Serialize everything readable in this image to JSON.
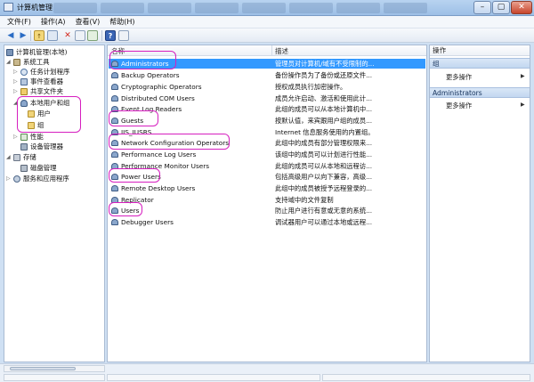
{
  "window": {
    "title": "计算机管理"
  },
  "menu": [
    "文件(F)",
    "操作(A)",
    "查看(V)",
    "帮助(H)"
  ],
  "toolbar": {
    "back_icon": "arrow-left-icon",
    "forward_icon": "arrow-right-icon",
    "up_icon": "folder-up-icon",
    "view_icon": "show-hide-console-tree-icon",
    "delete_icon": "delete-x-icon",
    "properties_icon": "properties-icon",
    "export_icon": "export-list-icon",
    "help_icon": "help-icon",
    "list_icon": "list-view-icon",
    "help_glyph": "?"
  },
  "tree": {
    "root": "计算机管理(本地)",
    "system_tools": "系统工具",
    "task_scheduler": "任务计划程序",
    "event_viewer": "事件查看器",
    "shared_folders": "共享文件夹",
    "local_users_groups": "本地用户和组",
    "users": "用户",
    "groups": "组",
    "performance": "性能",
    "device_manager": "设备管理器",
    "storage": "存储",
    "disk_management": "磁盘管理",
    "services_apps": "服务和应用程序"
  },
  "list": {
    "col_name": "名称",
    "col_desc": "描述",
    "rows": [
      {
        "name": "Administrators",
        "desc": "管理员对计算机/域有不受限制的..."
      },
      {
        "name": "Backup Operators",
        "desc": "备份操作员为了备份或还原文件..."
      },
      {
        "name": "Cryptographic Operators",
        "desc": "授权成员执行加密操作。"
      },
      {
        "name": "Distributed COM Users",
        "desc": "成员允许启动、激活和使用此计..."
      },
      {
        "name": "Event Log Readers",
        "desc": "此组的成员可以从本地计算机中..."
      },
      {
        "name": "Guests",
        "desc": "按默认值，来宾跟用户组的成员..."
      },
      {
        "name": "IIS_IUSRS",
        "desc": "Internet 信息服务使用的内置组。"
      },
      {
        "name": "Network Configuration Operators",
        "desc": "此组中的成员有部分管理权限来..."
      },
      {
        "name": "Performance Log Users",
        "desc": "该组中的成员可以计划进行性能..."
      },
      {
        "name": "Performance Monitor Users",
        "desc": "此组的成员可以从本地和远程访..."
      },
      {
        "name": "Power Users",
        "desc": "包括高级用户以向下兼容，高级..."
      },
      {
        "name": "Remote Desktop Users",
        "desc": "此组中的成员被授予远程登录的..."
      },
      {
        "name": "Replicator",
        "desc": "支持域中的文件复制"
      },
      {
        "name": "Users",
        "desc": "防止用户进行有意或无意的系统..."
      },
      {
        "name": "Debugger Users",
        "desc": "调试器用户可以通过本地或远程..."
      }
    ]
  },
  "actions": {
    "title": "操作",
    "section1": "组",
    "more1": "更多操作",
    "section2": "Administrators",
    "more2": "更多操作"
  },
  "colors": {
    "selection": "#3399ff",
    "highlight": "#d61fbf"
  }
}
